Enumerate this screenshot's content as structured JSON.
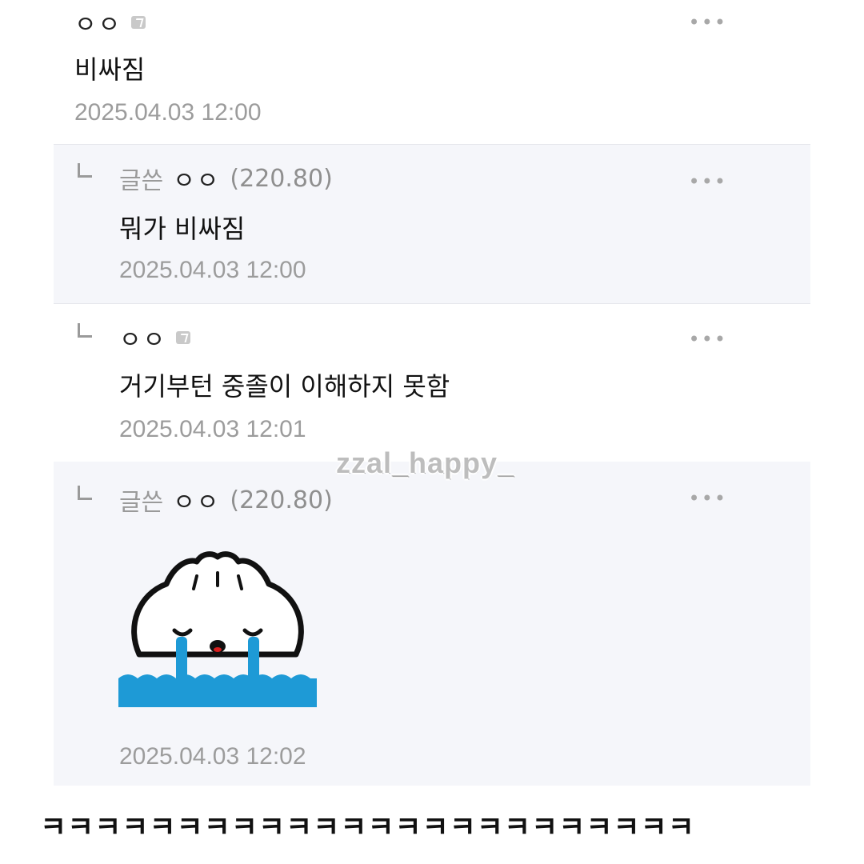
{
  "comments": [
    {
      "nickname": "ㅇㅇ",
      "text": "비싸짐",
      "date": "2025.04.03 12:00"
    },
    {
      "author_tag": "글쓴",
      "nickname": "ㅇㅇ",
      "ip": "(220.80)",
      "text": "뭐가 비싸짐",
      "date": "2025.04.03 12:00"
    },
    {
      "nickname": "ㅇㅇ",
      "text": "거기부턴 중졸이 이해하지 못함",
      "date": "2025.04.03 12:01"
    },
    {
      "author_tag": "글쓴",
      "nickname": "ㅇㅇ",
      "ip": "(220.80)",
      "sticker": "crying-dumpling-sticker",
      "date": "2025.04.03 12:02"
    }
  ],
  "more_label": "•••",
  "watermark": "zzal_happy_",
  "caption": "ㅋㅋㅋㅋㅋㅋㅋㅋㅋㅋㅋㅋㅋㅋㅋㅋㅋㅋㅋㅋㅋㅋㅋㅋ",
  "colors": {
    "author_bg": "#f5f6fa",
    "meta_gray": "#9c9c9c",
    "water_blue": "#1e9ad6"
  }
}
